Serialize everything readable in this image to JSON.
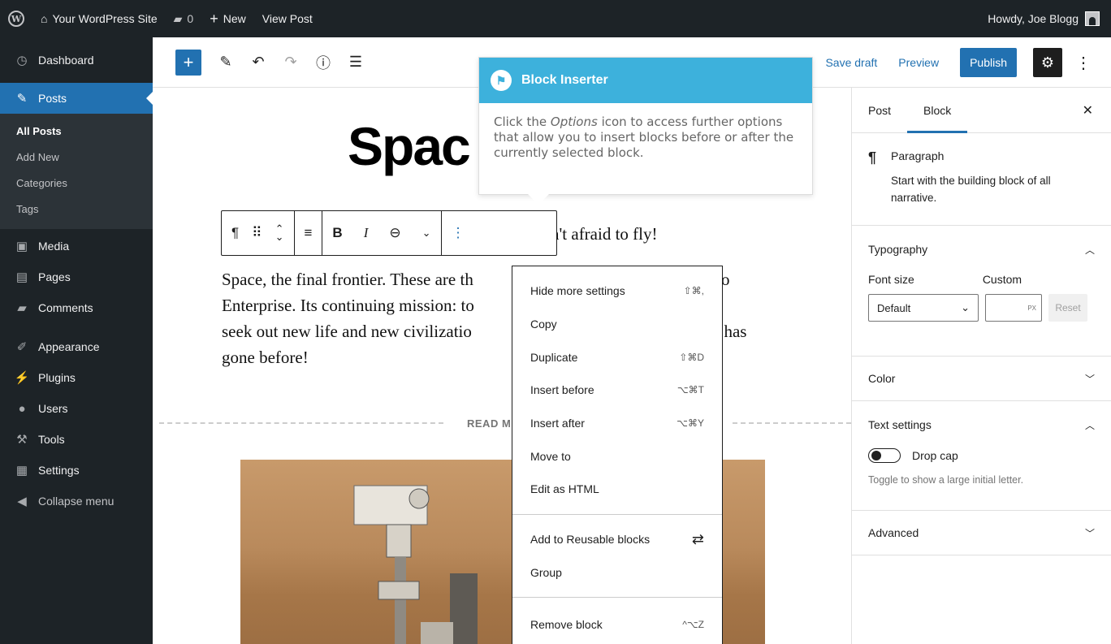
{
  "adminbar": {
    "site_name": "Your WordPress Site",
    "comments_count": "0",
    "new_label": "New",
    "view_post_label": "View Post",
    "howdy": "Howdy, Joe Blogg"
  },
  "sidebar": {
    "dashboard": "Dashboard",
    "posts": "Posts",
    "submenu": [
      "All Posts",
      "Add New",
      "Categories",
      "Tags"
    ],
    "media": "Media",
    "pages": "Pages",
    "comments": "Comments",
    "appearance": "Appearance",
    "plugins": "Plugins",
    "users": "Users",
    "tools": "Tools",
    "settings": "Settings",
    "collapse": "Collapse menu"
  },
  "header": {
    "save_draft": "Save draft",
    "preview": "Preview",
    "publish": "Publish"
  },
  "canvas": {
    "title": "Spac",
    "para1": "n't afraid to fly!",
    "para2": "Space, the final frontier. These are th                                    ds. To seek out new life and new civilizatio                                    one has gone before!",
    "para2_line1a": "Space, the final frontier. These are th",
    "para2_line1b": "ds. To",
    "para2_line2a": "Enterprise. Its continuing mission: to",
    "para2_line3a": "seek out new life and new civilizatio",
    "para2_line3b": "one has",
    "para2_line4a": "gone before!",
    "read_more": "READ M"
  },
  "tooltip": {
    "title": "Block Inserter",
    "body_pre": "Click the ",
    "body_em": "Options",
    "body_post": " icon to access further options that allow you to insert blocks before or after the currently selected block."
  },
  "options_menu": {
    "group1": [
      {
        "label": "Hide more settings",
        "shortcut": "⇧⌘,"
      },
      {
        "label": "Copy",
        "shortcut": ""
      },
      {
        "label": "Duplicate",
        "shortcut": "⇧⌘D"
      },
      {
        "label": "Insert before",
        "shortcut": "⌥⌘T"
      },
      {
        "label": "Insert after",
        "shortcut": "⌥⌘Y"
      },
      {
        "label": "Move to",
        "shortcut": ""
      },
      {
        "label": "Edit as HTML",
        "shortcut": ""
      }
    ],
    "group2": [
      {
        "label": "Add to Reusable blocks"
      },
      {
        "label": "Group"
      }
    ],
    "remove": {
      "label": "Remove block",
      "shortcut": "^⌥Z"
    }
  },
  "settings_panel": {
    "tab_post": "Post",
    "tab_block": "Block",
    "block_name": "Paragraph",
    "block_desc": "Start with the building block of all narrative.",
    "typography": "Typography",
    "font_size_label": "Font size",
    "custom_label": "Custom",
    "font_size_value": "Default",
    "px_unit": "PX",
    "reset": "Reset",
    "color": "Color",
    "text_settings": "Text settings",
    "drop_cap": "Drop cap",
    "drop_cap_help": "Toggle to show a large initial letter.",
    "advanced": "Advanced"
  },
  "colors": {
    "admin_dark": "#1d2327",
    "accent_blue": "#2271b1",
    "tooltip_blue": "#3db1dc"
  }
}
